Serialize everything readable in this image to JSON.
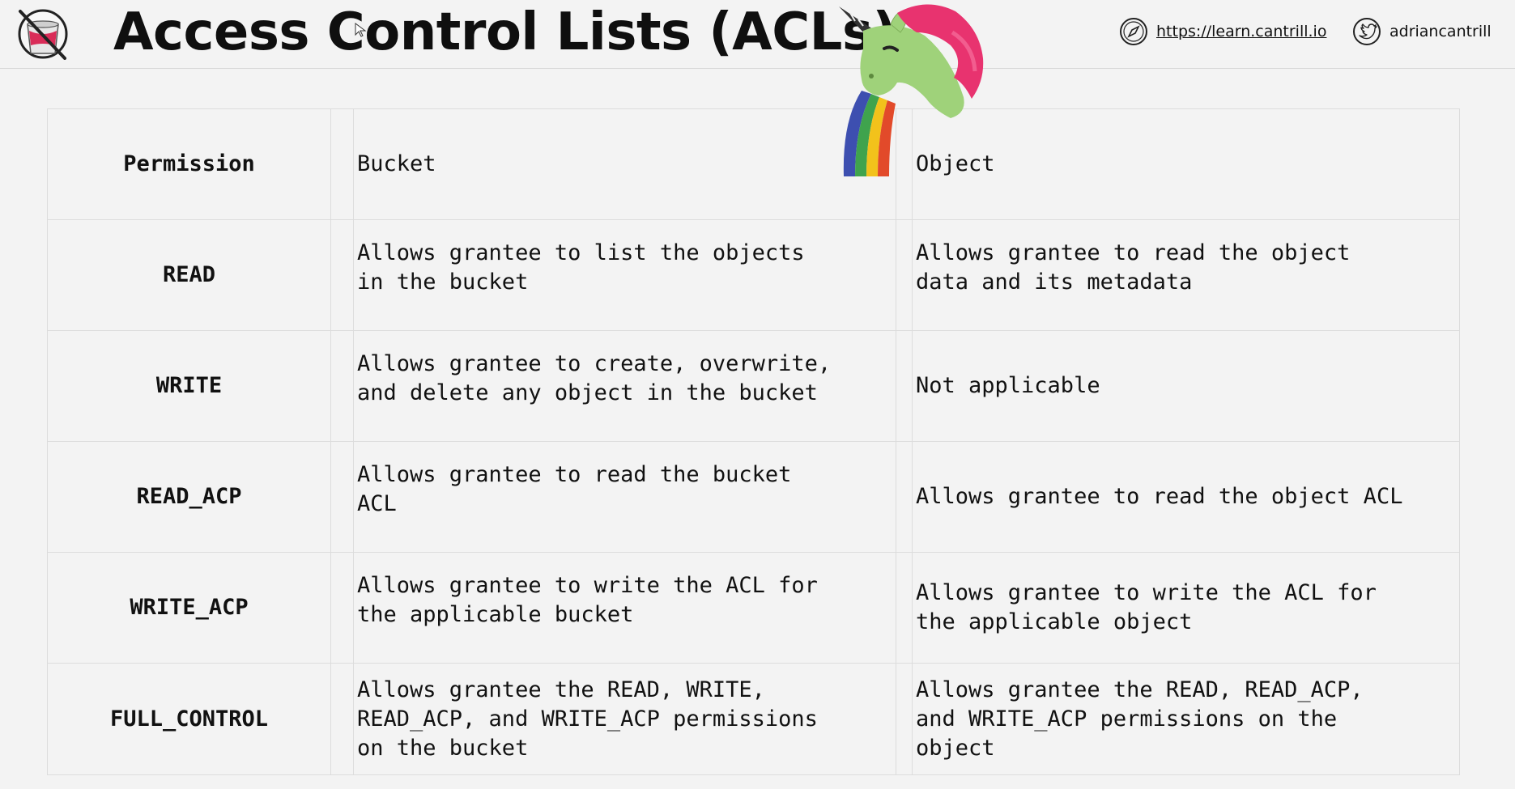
{
  "header": {
    "title": "Access Control Lists (ACLs)",
    "site_link": "https://learn.cantrill.io",
    "twitter_handle": "adriancantrill"
  },
  "table": {
    "columns": [
      "Permission",
      "Bucket",
      "Object"
    ],
    "rows": [
      {
        "permission": "READ",
        "bucket": [
          "Allows grantee to list the objects",
          "in the bucket"
        ],
        "object": [
          "Allows grantee to read the object",
          "data and its metadata"
        ]
      },
      {
        "permission": "WRITE",
        "bucket": [
          "Allows grantee to create, overwrite,",
          "and delete any object in the bucket"
        ],
        "object": [
          "Not applicable"
        ]
      },
      {
        "permission": "READ_ACP",
        "bucket": [
          "Allows grantee to read the bucket",
          "ACL"
        ],
        "object": [
          "Allows grantee to read the object ACL"
        ]
      },
      {
        "permission": "WRITE_ACP",
        "bucket": [
          "Allows grantee to write the ACL for",
          "the applicable bucket"
        ],
        "object": [
          "Allows grantee to write the ACL for",
          "the applicable object"
        ]
      },
      {
        "permission": "FULL_CONTROL",
        "bucket": [
          "Allows grantee the READ, WRITE,",
          "READ_ACP, and WRITE_ACP permissions",
          "on the bucket"
        ],
        "object": [
          "Allows grantee the READ, READ_ACP,",
          "and WRITE_ACP permissions on the",
          "object"
        ]
      }
    ]
  },
  "colors": {
    "background": "#f3f3f3",
    "grid": "#dcdcdc",
    "text": "#111111",
    "unicorn_body": "#9fd27a",
    "unicorn_mane": "#e8336f"
  },
  "icons": [
    "paint-bucket-logo-icon",
    "cursor-icon",
    "compass-icon",
    "twitter-bird-icon",
    "unicorn-rainbow-icon"
  ]
}
